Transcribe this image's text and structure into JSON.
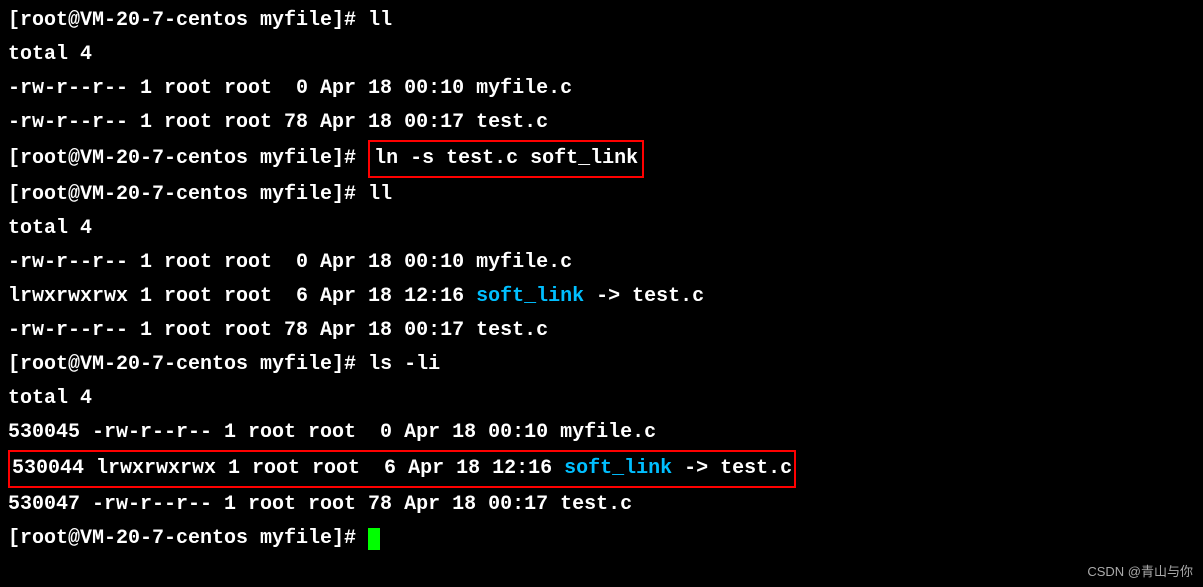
{
  "prompt1": "[root@VM-20-7-centos myfile]# ",
  "cmd_ll": "ll",
  "total": "total 4",
  "ls1_row1": "-rw-r--r-- 1 root root  0 Apr 18 00:10 myfile.c",
  "ls1_row2": "-rw-r--r-- 1 root root 78 Apr 18 00:17 test.c",
  "cmd_ln": "ln -s test.c soft_link",
  "ls2_row1": "-rw-r--r-- 1 root root  0 Apr 18 00:10 myfile.c",
  "ls2_row2_pre": "lrwxrwxrwx 1 root root  6 Apr 18 12:16 ",
  "soft_link_name": "soft_link",
  "ls2_row2_post": " -> test.c",
  "ls2_row3": "-rw-r--r-- 1 root root 78 Apr 18 00:17 test.c",
  "cmd_lsli": "ls -li",
  "ls3_row1": "530045 -rw-r--r-- 1 root root  0 Apr 18 00:10 myfile.c",
  "ls3_row2_pre": "530044 lrwxrwxrwx 1 root root  6 Apr 18 12:16 ",
  "ls3_row2_post": " -> test.c",
  "ls3_row3": "530047 -rw-r--r-- 1 root root 78 Apr 18 00:17 test.c",
  "watermark": "CSDN @青山与你"
}
